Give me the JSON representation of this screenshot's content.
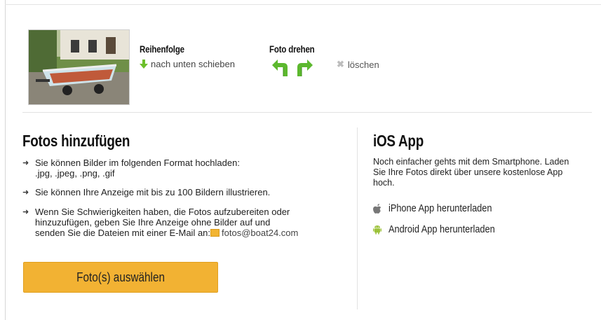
{
  "photo_row": {
    "order_title": "Reihenfolge",
    "move_down_label": "nach unten schieben",
    "rotate_title": "Foto drehen",
    "delete_label": "löschen"
  },
  "add_photos": {
    "title": "Fotos hinzufügen",
    "bullets": [
      "Sie können Bilder im folgenden Format hochladen:\n.jpg, .jpeg, .png, .gif",
      "Sie können Ihre Anzeige mit bis zu 100 Bildern illustrieren.",
      "Wenn Sie Schwierigkeiten haben, die Fotos aufzubereiten oder\nhinzuzufügen, geben Sie Ihre Anzeige ohne Bilder auf und\nsenden Sie die Dateien mit einer E-Mail an:"
    ],
    "email": "fotos@boat24.com",
    "select_button": "Foto(s) auswählen"
  },
  "ios_app": {
    "title": "iOS App",
    "text": "Noch einfacher gehts mit dem Smartphone. Laden Sie Ihre Fotos direkt über unsere kostenlose App hoch.",
    "iphone_link": "iPhone App herunterladen",
    "android_link": "Android App herunterladen"
  },
  "colors": {
    "button_bg": "#f2b233",
    "rotate_green": "#5cb82e",
    "android_green": "#9cc23a"
  },
  "icons": [
    "arrow-down-icon",
    "rotate-left-icon",
    "rotate-right-icon",
    "delete-x-icon",
    "mail-icon",
    "apple-icon",
    "android-icon",
    "bullet-arrow-icon"
  ]
}
